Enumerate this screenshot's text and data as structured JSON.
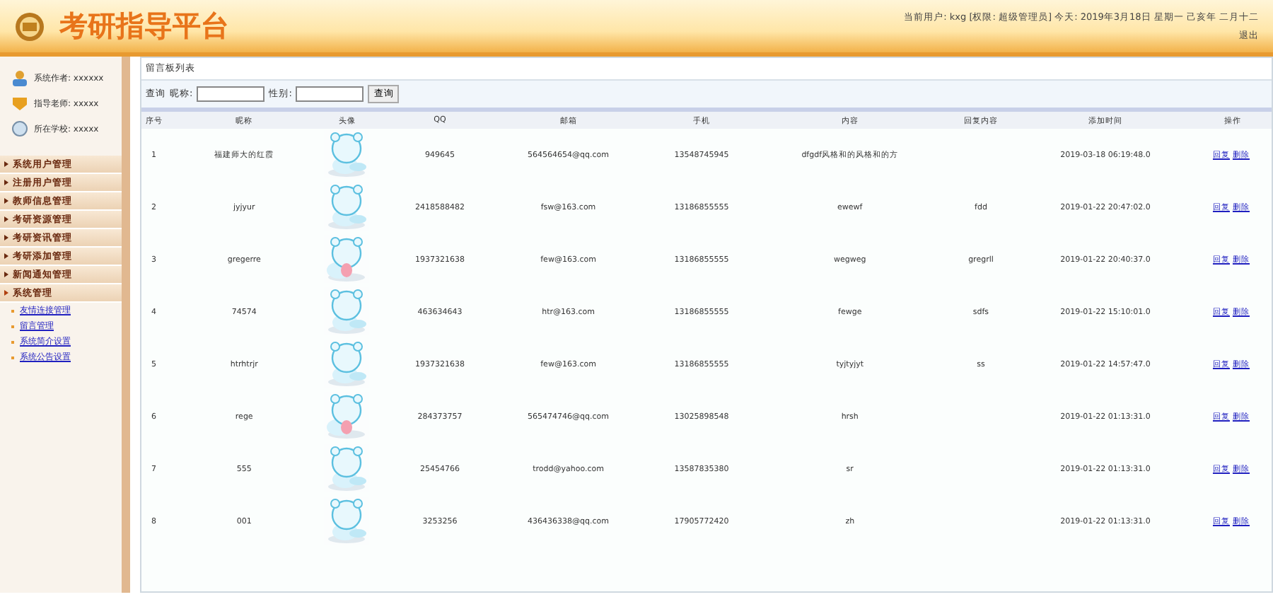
{
  "header": {
    "title": "考研指导平台",
    "user_info": "当前用户: kxg [权限: 超级管理员] 今天: 2019年3月18日 星期一 己亥年 二月十二",
    "logout": "退出"
  },
  "sidebar": {
    "info": [
      {
        "label": "系统作者: xxxxxx",
        "kind": "author"
      },
      {
        "label": "指导老师: xxxxx",
        "kind": "teacher"
      },
      {
        "label": "所在学校: xxxxx",
        "kind": "school"
      }
    ],
    "menu": [
      {
        "label": "系统用户管理",
        "expanded": false
      },
      {
        "label": "注册用户管理",
        "expanded": false
      },
      {
        "label": "教师信息管理",
        "expanded": false
      },
      {
        "label": "考研资源管理",
        "expanded": false
      },
      {
        "label": "考研资讯管理",
        "expanded": false
      },
      {
        "label": "考研添加管理",
        "expanded": false
      },
      {
        "label": "新闻通知管理",
        "expanded": false
      },
      {
        "label": "系统管理",
        "expanded": true,
        "children": [
          "友情连接管理",
          "留言管理",
          "系统简介设置",
          "系统公告设置"
        ]
      }
    ]
  },
  "panel": {
    "title": "留言板列表",
    "search_label": "查询",
    "fields": [
      {
        "label": "昵称:"
      },
      {
        "label": "性别:"
      }
    ],
    "search_button": "查询"
  },
  "table": {
    "columns": [
      "序号",
      "昵称",
      "头像",
      "QQ",
      "邮箱",
      "手机",
      "内容",
      "回复内容",
      "添加时间",
      "操作"
    ],
    "rows": [
      {
        "no": "1",
        "nickname": "福建师大的红霞",
        "qq": "949645",
        "email": "564564654@qq.com",
        "phone": "13548745945",
        "content": "dfgdf风格和的风格和的方",
        "reply": "",
        "time": "2019-03-18 06:19:48.0",
        "actions": [
          "回复",
          "删除"
        ]
      },
      {
        "no": "2",
        "nickname": "jyjyur",
        "qq": "2418588482",
        "email": "fsw@163.com",
        "phone": "13186855555",
        "content": "ewewf",
        "reply": "fdd",
        "time": "2019-01-22 20:47:02.0",
        "actions": [
          "回复",
          "删除"
        ]
      },
      {
        "no": "3",
        "nickname": "gregerre",
        "qq": "1937321638",
        "email": "few@163.com",
        "phone": "13186855555",
        "content": "wegweg",
        "reply": "gregrll",
        "time": "2019-01-22 20:40:37.0",
        "actions": [
          "回复",
          "删除"
        ]
      },
      {
        "no": "4",
        "nickname": "74574",
        "qq": "463634643",
        "email": "htr@163.com",
        "phone": "13186855555",
        "content": "fewge",
        "reply": "sdfs",
        "time": "2019-01-22 15:10:01.0",
        "actions": [
          "回复",
          "删除"
        ]
      },
      {
        "no": "5",
        "nickname": "htrhtrjr",
        "qq": "1937321638",
        "email": "few@163.com",
        "phone": "13186855555",
        "content": "tyjtyjyt",
        "reply": "ss",
        "time": "2019-01-22 14:57:47.0",
        "actions": [
          "回复",
          "删除"
        ]
      },
      {
        "no": "6",
        "nickname": "rege",
        "qq": "284373757",
        "email": "565474746@qq.com",
        "phone": "13025898548",
        "content": "hrsh",
        "reply": "",
        "time": "2019-01-22 01:13:31.0",
        "actions": [
          "回复",
          "删除"
        ]
      },
      {
        "no": "7",
        "nickname": "555",
        "qq": "25454766",
        "email": "trodd@yahoo.com",
        "phone": "13587835380",
        "content": "sr",
        "reply": "",
        "time": "2019-01-22 01:13:31.0",
        "actions": [
          "回复",
          "删除"
        ]
      },
      {
        "no": "8",
        "nickname": "001",
        "qq": "3253256",
        "email": "436436338@qq.com",
        "phone": "17905772420",
        "content": "zh",
        "reply": "",
        "time": "2019-01-22 01:13:31.0",
        "actions": [
          "回复",
          "删除"
        ]
      }
    ]
  }
}
